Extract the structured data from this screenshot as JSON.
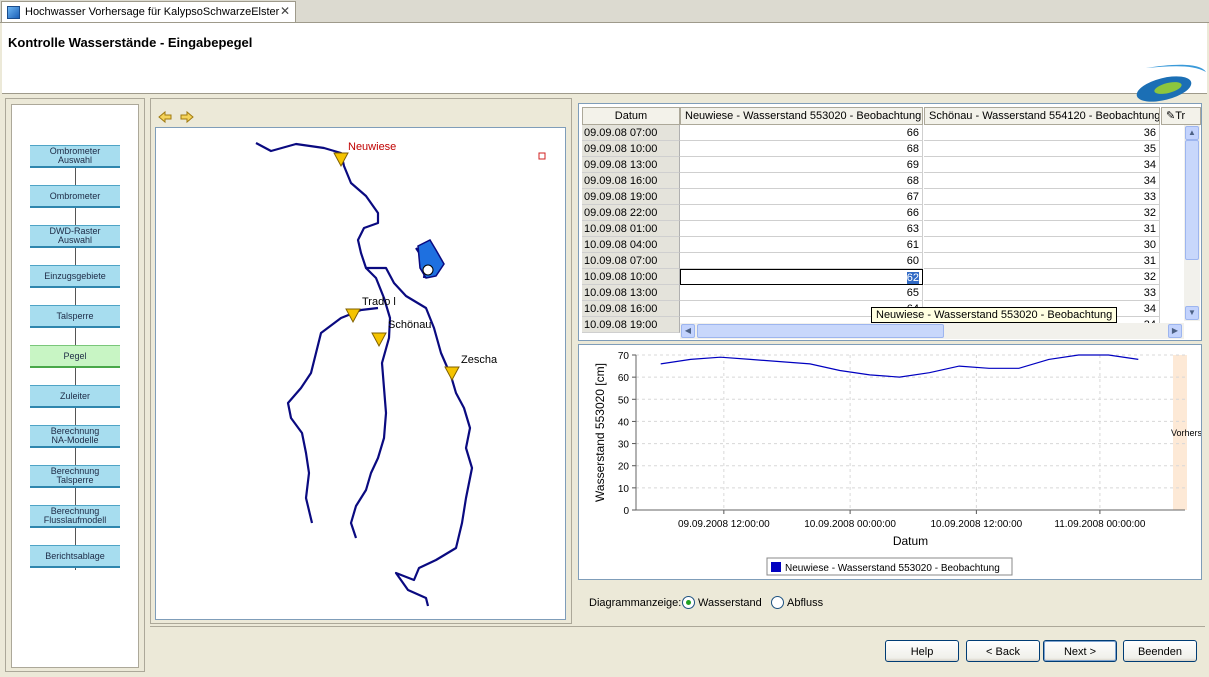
{
  "window": {
    "tab_title": "Hochwasser Vorhersage für KalypsoSchwarzeElster",
    "close_glyph": "✕"
  },
  "header": {
    "title": "Kontrolle Wasserstände - Eingabepegel"
  },
  "workflow": {
    "steps": [
      "Ombrometer\nAuswahl",
      "Ombrometer",
      "DWD-Raster\nAuswahl",
      "Einzugsgebiete",
      "Talsperre",
      "Pegel",
      "Zuleiter",
      "Berechnung\nNA-Modelle",
      "Berechnung\nTalsperre",
      "Berechnung\nFlusslaufmodell",
      "Berichtsablage"
    ],
    "active_index": 5
  },
  "map": {
    "nav_back_icon": "arrow-left-icon",
    "nav_forward_icon": "arrow-right-icon",
    "labels": {
      "neuwiese": "Neuwiese",
      "trado": "Trado l",
      "schoenau": "Schönau",
      "zescha": "Zescha"
    },
    "colors": {
      "river": "#0a0a80",
      "gauge": "#f5c400",
      "highlight_label": "#c00000"
    }
  },
  "table": {
    "headers": {
      "date": "Datum",
      "col1": "Neuwiese - Wasserstand 553020 - Beobachtung",
      "col2": "Schönau - Wasserstand 554120 - Beobachtung",
      "col3": "Tr"
    },
    "rows": [
      {
        "date": "09.09.08 07:00",
        "v1": "66",
        "v2": "36"
      },
      {
        "date": "09.09.08 10:00",
        "v1": "68",
        "v2": "35"
      },
      {
        "date": "09.09.08 13:00",
        "v1": "69",
        "v2": "34"
      },
      {
        "date": "09.09.08 16:00",
        "v1": "68",
        "v2": "34"
      },
      {
        "date": "09.09.08 19:00",
        "v1": "67",
        "v2": "33"
      },
      {
        "date": "09.09.08 22:00",
        "v1": "66",
        "v2": "32"
      },
      {
        "date": "10.09.08 01:00",
        "v1": "63",
        "v2": "31"
      },
      {
        "date": "10.09.08 04:00",
        "v1": "61",
        "v2": "30"
      },
      {
        "date": "10.09.08 07:00",
        "v1": "60",
        "v2": "31"
      },
      {
        "date": "10.09.08 10:00",
        "v1": "62",
        "v2": "32"
      },
      {
        "date": "10.09.08 13:00",
        "v1": "65",
        "v2": "33"
      },
      {
        "date": "10.09.08 16:00",
        "v1": "64",
        "v2": "34"
      },
      {
        "date": "10.09.08 19:00",
        "v1": "64",
        "v2": "34"
      }
    ],
    "selected_row": 9,
    "tooltip": "Neuwiese - Wasserstand 553020 - Beobachtung"
  },
  "chart_data": {
    "type": "line",
    "title": "",
    "xlabel": "Datum",
    "ylabel": "Wasserstand 553020 [cm]",
    "ylim": [
      0,
      70
    ],
    "yticks": [
      0,
      10,
      20,
      30,
      40,
      50,
      60,
      70
    ],
    "xticks": [
      "09.09.2008 12:00:00",
      "10.09.2008 00:00:00",
      "10.09.2008 12:00:00",
      "11.09.2008 00:00:00"
    ],
    "x": [
      "09.09.2008 07:00",
      "09.09.2008 10:00",
      "09.09.2008 13:00",
      "09.09.2008 16:00",
      "09.09.2008 19:00",
      "09.09.2008 22:00",
      "10.09.2008 01:00",
      "10.09.2008 04:00",
      "10.09.2008 07:00",
      "10.09.2008 10:00",
      "10.09.2008 13:00",
      "10.09.2008 16:00",
      "10.09.2008 19:00",
      "10.09.2008 22:00",
      "11.09.2008 01:00",
      "11.09.2008 04:00"
    ],
    "series": [
      {
        "name": "Neuwiese - Wasserstand 553020 - Beobachtung",
        "color": "#0000c0",
        "values": [
          66,
          68,
          69,
          68,
          67,
          66,
          63,
          61,
          60,
          62,
          65,
          64,
          64,
          68,
          70,
          70,
          68
        ]
      }
    ],
    "forecast_label": "Vorhers",
    "legend_position": "bottom",
    "grid": true
  },
  "diagram": {
    "label": "Diagrammanzeige:",
    "options": [
      "Wasserstand",
      "Abfluss"
    ],
    "selected": 0
  },
  "buttons": {
    "help": "Help",
    "back": "< Back",
    "next": "Next >",
    "finish": "Beenden"
  }
}
